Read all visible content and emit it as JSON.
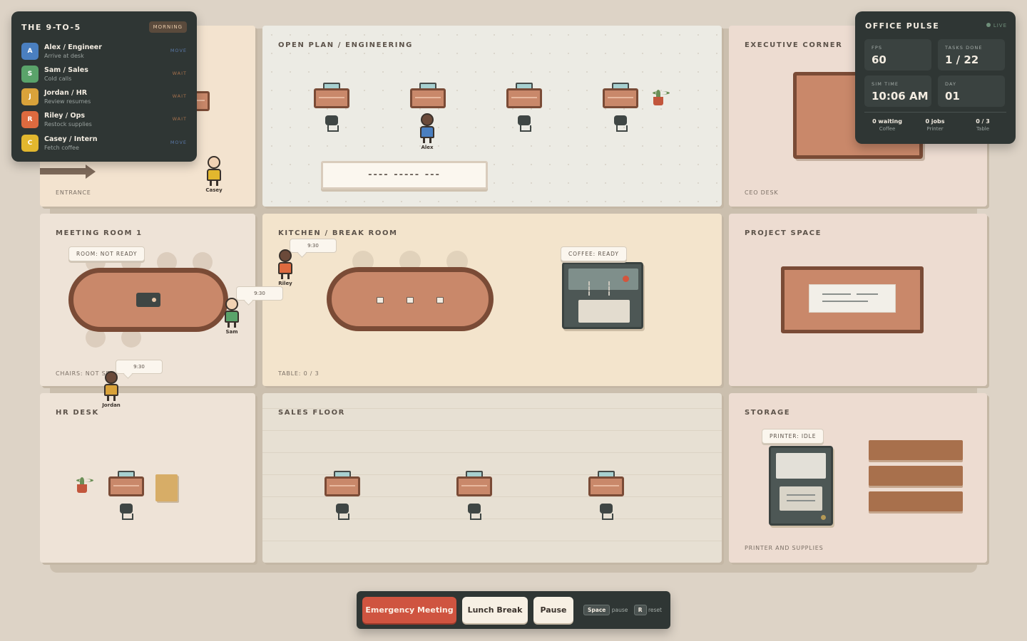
{
  "roster": {
    "title": "THE 9-TO-5",
    "phase": "MORNING",
    "agents": [
      {
        "initial": "A",
        "name": "Alex / Engineer",
        "task": "Arrive at desk",
        "state": "MOVE",
        "color": "#4a7fc0",
        "state_color": "#5a78a8"
      },
      {
        "initial": "S",
        "name": "Sam / Sales",
        "task": "Cold calls",
        "state": "WAIT",
        "color": "#5aa36a",
        "state_color": "#a5704c"
      },
      {
        "initial": "J",
        "name": "Jordan / HR",
        "task": "Review resumes",
        "state": "WAIT",
        "color": "#d9a23a",
        "state_color": "#a5704c"
      },
      {
        "initial": "R",
        "name": "Riley / Ops",
        "task": "Restock supplies",
        "state": "WAIT",
        "color": "#dd6a3f",
        "state_color": "#a5704c"
      },
      {
        "initial": "C",
        "name": "Casey / Intern",
        "task": "Fetch coffee",
        "state": "MOVE",
        "color": "#e2b72e",
        "state_color": "#5a78a8"
      }
    ]
  },
  "pulse": {
    "title": "OFFICE PULSE",
    "live": "LIVE",
    "fps_label": "FPS",
    "fps": "60",
    "tasks_label": "TASKS DONE",
    "tasks": "1 / 22",
    "time_label": "SIM TIME",
    "time": "10:06 AM",
    "day_label": "DAY",
    "day": "01",
    "queues": [
      {
        "value": "0 waiting",
        "label": "Coffee"
      },
      {
        "value": "0 jobs",
        "label": "Printer"
      },
      {
        "value": "0 / 3",
        "label": "Table"
      }
    ]
  },
  "rooms": {
    "entrance": {
      "caption": "ENTRANCE"
    },
    "open_plan": {
      "title": "OPEN PLAN / ENGINEERING",
      "whiteboard": "---- ----- ---"
    },
    "executive": {
      "title": "EXECUTIVE CORNER",
      "caption": "CEO DESK"
    },
    "meeting": {
      "title": "MEETING ROOM 1",
      "tag": "ROOM: NOT READY",
      "caption": "CHAIRS: NOT SE"
    },
    "kitchen": {
      "title": "KITCHEN / BREAK ROOM",
      "caption": "TABLE: 0 / 3",
      "coffee_tag": "COFFEE: READY"
    },
    "project": {
      "title": "PROJECT SPACE"
    },
    "hr": {
      "title": "HR DESK"
    },
    "sales": {
      "title": "SALES FLOOR"
    },
    "storage": {
      "title": "STORAGE",
      "printer_tag": "PRINTER: IDLE",
      "caption": "PRINTER AND SUPPLIES"
    }
  },
  "people": {
    "alex": {
      "name": "Alex",
      "color": "#4a7fc0"
    },
    "sam": {
      "name": "Sam",
      "color": "#5aa36a"
    },
    "jordan": {
      "name": "Jordan",
      "color": "#d9a23a"
    },
    "riley": {
      "name": "Riley",
      "color": "#dd6a3f"
    },
    "casey": {
      "name": "Casey",
      "color": "#e2b72e"
    }
  },
  "bubbles": {
    "sam": "9:30",
    "jordan": "9:30",
    "riley": "9:30"
  },
  "controls": {
    "emergency": "Emergency Meeting",
    "lunch": "Lunch Break",
    "pause": "Pause",
    "space_key": "Space",
    "space_hint": "pause",
    "reset_key": "R",
    "reset_hint": "reset"
  }
}
